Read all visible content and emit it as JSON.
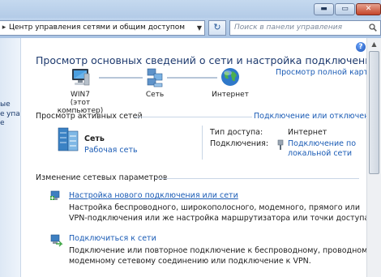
{
  "titlebar": {
    "minimize": "▬",
    "maximize": "▭",
    "close": "✕"
  },
  "address": {
    "back_arrow": "▸",
    "path": "Центр управления сетями и общим доступом",
    "dropdown": "▼",
    "refresh": "↻"
  },
  "search": {
    "placeholder": "Поиск в панели управления",
    "icon": "search-icon"
  },
  "leftpane": {
    "line1": "ые",
    "line2": "е",
    "line3": "упа",
    "line4": "е"
  },
  "help": "?",
  "main": {
    "title": "Просмотр основных сведений о сети и настройка подключений",
    "full_map_link": "Просмотр полной карты",
    "map": {
      "computer_name": "WIN7",
      "computer_note": "(этот компьютер)",
      "network": "Сеть",
      "internet": "Интернет"
    },
    "active_header": "Просмотр активных сетей",
    "connect_disconnect": "Подключение или отключение",
    "active": {
      "name": "Сеть",
      "type": "Рабочая сеть",
      "access_label": "Тип доступа:",
      "access_value": "Интернет",
      "connections_label": "Подключения:",
      "connection_link_1": "Подключение по",
      "connection_link_2": "локальной сети"
    },
    "change_header": "Изменение сетевых параметров",
    "tasks": [
      {
        "title": "Настройка нового подключения или сети",
        "desc_1": "Настройка беспроводного, широкополосного, модемного, прямого или",
        "desc_2": "VPN-подключения или же настройка маршрутизатора или точки доступа."
      },
      {
        "title": "Подключиться к сети",
        "desc_1": "Подключение или повторное подключение к беспроводному, проводному,",
        "desc_2": "модемному сетевому соединению или подключение к VPN."
      }
    ]
  }
}
